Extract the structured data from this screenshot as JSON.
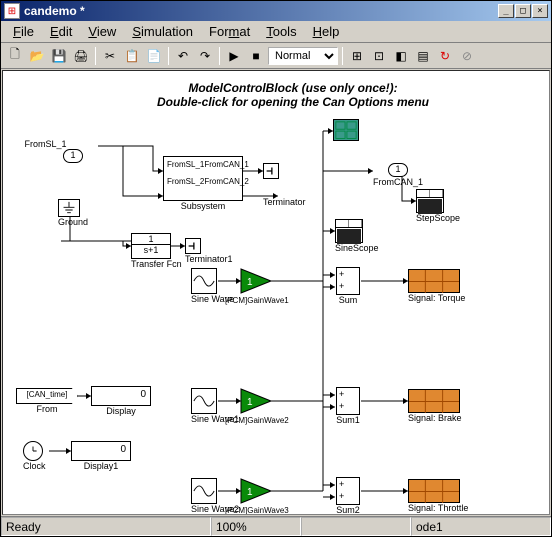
{
  "window": {
    "title": "candemo *"
  },
  "menu": {
    "file": "ile",
    "edit": "dit",
    "view": "iew",
    "simulation": "imulation",
    "tools": "ools",
    "help": "elp"
  },
  "toolbar": {
    "mode": "Normal"
  },
  "canvas": {
    "header1": "ModelControlBlock (use only once!):",
    "header2": "Double-click for opening the Can Options menu"
  },
  "blocks": {
    "fromsl1": "FromSL_1",
    "ground": "Ground",
    "subsystem": "Subsystem",
    "sub_in1": "FromSL_1",
    "sub_out1": "FromCAN_1",
    "sub_in2": "FromSL_2",
    "sub_out2": "FromCAN_2",
    "terminator": "Terminator",
    "terminator1": "Terminator1",
    "transfer_fcn": "Transfer Fcn",
    "tf_num": "1",
    "tf_den": "s+1",
    "fromcan1": "FromCAN_1",
    "stepscope": "StepScope",
    "sinescope": "SineScope",
    "sinewave": "Sine Wave",
    "gainwave1": "[PCM]GainWave1",
    "sum": "Sum",
    "signal_torque": "Signal: Torque",
    "from_tag": "[CAN_time]",
    "from": "From",
    "display_val": "0",
    "display": "Display",
    "sinewave1": "Sine Wave1",
    "gainwave2": "[PCM]GainWave2",
    "sum1": "Sum1",
    "signal_brake": "Signal: Brake",
    "clock": "Clock",
    "display1_val": "0",
    "display1": "Display1",
    "sinewave2": "Sine Wave2",
    "gainwave3": "[PCM]GainWave3",
    "sum2": "Sum2",
    "signal_throttle": "Signal: Throttle"
  },
  "status": {
    "ready": "Ready",
    "zoom": "100%",
    "solver": "ode1"
  }
}
